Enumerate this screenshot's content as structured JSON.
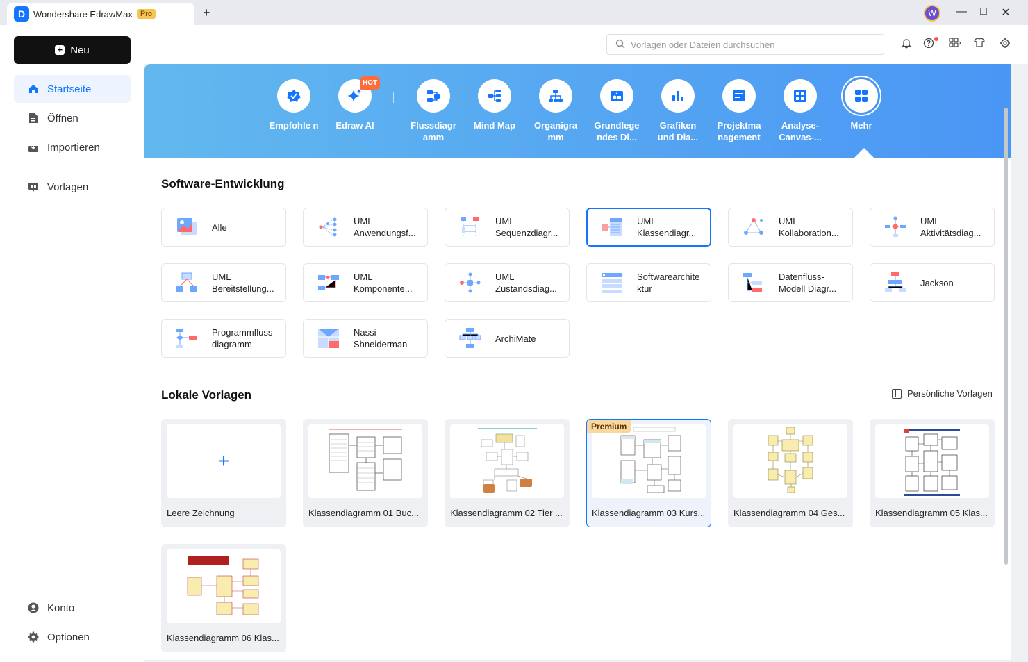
{
  "app": {
    "title": "Wondershare EdrawMax",
    "badge": "Pro",
    "logo_letter": "D",
    "avatar_letter": "W"
  },
  "sidebar": {
    "new_label": "Neu",
    "items": [
      {
        "label": "Startseite",
        "icon": "home-icon"
      },
      {
        "label": "Öffnen",
        "icon": "file-icon"
      },
      {
        "label": "Importieren",
        "icon": "import-icon"
      },
      {
        "label": "Vorlagen",
        "icon": "templates-icon"
      }
    ],
    "bottom": [
      {
        "label": "Konto",
        "icon": "user-icon"
      },
      {
        "label": "Optionen",
        "icon": "gear-icon"
      }
    ]
  },
  "search": {
    "placeholder": "Vorlagen oder Dateien durchsuchen"
  },
  "categories": [
    {
      "label": "Empfohle n",
      "icon": "recommend-icon"
    },
    {
      "label": "Edraw AI",
      "icon": "ai-sparkle-icon",
      "badge": "HOT"
    },
    {
      "label": "Flussdiagr amm",
      "icon": "flowchart-icon"
    },
    {
      "label": "Mind Map",
      "icon": "mindmap-icon"
    },
    {
      "label": "Organigra mm",
      "icon": "orgchart-icon"
    },
    {
      "label": "Grundlege ndes Di...",
      "icon": "basic-diagram-icon"
    },
    {
      "label": "Grafiken und Dia...",
      "icon": "bar-chart-icon"
    },
    {
      "label": "Projektma nagement",
      "icon": "project-icon"
    },
    {
      "label": "Analyse- Canvas-...",
      "icon": "canvas-icon"
    },
    {
      "label": "Mehr",
      "icon": "grid-more-icon"
    }
  ],
  "section1": {
    "title": "Software-Entwicklung",
    "cards": [
      {
        "label": "Alle"
      },
      {
        "label": "UML\nAnwendungsf..."
      },
      {
        "label": "UML\nSequenzdiagr..."
      },
      {
        "label": "UML\nKlassendiagr..."
      },
      {
        "label": "UML\nKollaboration..."
      },
      {
        "label": "UML\nAktivitätsdiag..."
      },
      {
        "label": "UML\nBereitstellung..."
      },
      {
        "label": "UML\nKomponente..."
      },
      {
        "label": "UML\nZustandsdiag..."
      },
      {
        "label": "Softwarearchite\nktur"
      },
      {
        "label": "Datenfluss-\nModell Diagr..."
      },
      {
        "label": "Jackson"
      },
      {
        "label": "Programmfluss\ndiagramm"
      },
      {
        "label": "Nassi-\nShneiderman"
      },
      {
        "label": "ArchiMate"
      }
    ]
  },
  "section2": {
    "title": "Lokale Vorlagen",
    "personal_label": "Persönliche Vorlagen",
    "templates": [
      {
        "label": "Leere Zeichnung"
      },
      {
        "label": "Klassendiagramm 01 Buc..."
      },
      {
        "label": "Klassendiagramm 02 Tier ..."
      },
      {
        "label": "Klassendiagramm 03 Kurs...",
        "badge": "Premium"
      },
      {
        "label": "Klassendiagramm 04 Ges..."
      },
      {
        "label": "Klassendiagramm 05 Klas..."
      },
      {
        "label": "Klassendiagramm 06 Klas..."
      }
    ]
  },
  "colors": {
    "accent": "#1476ff",
    "banner_start": "#62b8ee",
    "banner_end": "#4a96f5"
  }
}
